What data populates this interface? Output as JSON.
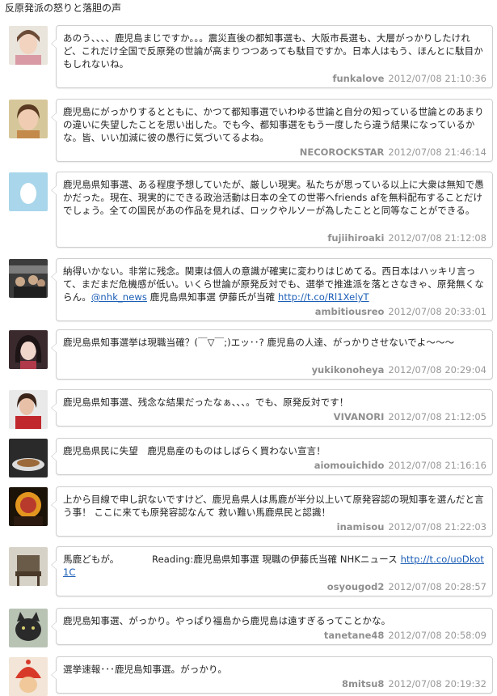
{
  "title": "反原発派の怒りと落胆の声",
  "tweets": [
    {
      "user": "funkalove",
      "time": "2012/07/08 21:10:36",
      "text": "あのう、、、、鹿児島まじですか。。。震災直後の都知事選も、大阪市長選も、大層がっかりしたけれど、これだけ全国で反原発の世論が高まりつつあっても駄目ですか。日本人はもう、ほんとに駄目かもしれないね。",
      "link": ""
    },
    {
      "user": "NECOROCKSTAR",
      "time": "2012/07/08 21:46:14",
      "text": "鹿児島にがっかりするとともに、かつて都知事選でいわゆる世論と自分の知っている世論とのあまりの違いに失望したことを思い出した。でも今、都知事選をもう一度したら違う結果になっているかな。皆、いい加減に彼の愚行に気づいてるよね。",
      "link": ""
    },
    {
      "user": "fujiihiroaki",
      "time": "2012/07/08 21:12:08",
      "text": "鹿児島県知事選、ある程度予想していたが、厳しい現実。私たちが思っている以上に大衆は無知で愚かだった。現在、現実的にできる政治活動は日本の全ての世帯へfriends afを無料配布することだけでしょう。全ての国民があの作品を見れば、ロックやルソーが為したことと同等なことができる。",
      "link": ""
    },
    {
      "user": "ambitiousreo",
      "time": "2012/07/08 20:33:01",
      "text": "納得いかない。非常に残念。関東は個人の意識が確実に変わりはじめてる。西日本はハッキリ言って、まだまだ危機感が低い。いくら世論が原発反対でも、選挙で推進派を落とさなきゃ、原発無くならん。",
      "mention": "@nhk_news",
      "text2": " 鹿児島県知事選 伊藤氏が当確 ",
      "link": "http://t.co/Rl1XelyT"
    },
    {
      "user": "yukikonoheya",
      "time": "2012/07/08 20:29:04",
      "text": "鹿児島県知事選挙は現職当確？(￣▽￣;)エッ･･?  鹿児島の人達、がっかりさせないでよ～～～",
      "link": ""
    },
    {
      "user": "VIVANORI",
      "time": "2012/07/08 21:12:05",
      "text": "鹿児島県知事選、残念な結果だったなぁ、、、。でも、原発反対です！",
      "link": ""
    },
    {
      "user": "aiomouichido",
      "time": "2012/07/08 21:16:16",
      "text": "鹿児島県民に失望　鹿児島産のものはしばらく買わない宣言！",
      "link": ""
    },
    {
      "user": "inamisou",
      "time": "2012/07/08 21:22:03",
      "text": "上から目線で申し訳ないですけど、鹿児島県人は馬鹿が半分以上いて原発容認の現知事を選んだと言う事！ ここに来ても原発容認なんて 救い難い馬鹿県民と認識！",
      "link": ""
    },
    {
      "user": "osyougod2",
      "time": "2012/07/08 20:28:57",
      "text": "馬鹿どもが。　　　　Reading:鹿児島県知事選 現職の伊藤氏当確  NHKニュース ",
      "link": "http://t.co/uoDkot1C"
    },
    {
      "user": "tanetane48",
      "time": "2012/07/08 20:58:09",
      "text": "鹿児島知事選、がっかり。やっぱり福島から鹿児島は遠すぎるってことかな。",
      "link": ""
    },
    {
      "user": "8mitsu8",
      "time": "2012/07/08 20:19:32",
      "text": "選挙速報･･･鹿児島知事選。がっかり。",
      "link": ""
    }
  ]
}
